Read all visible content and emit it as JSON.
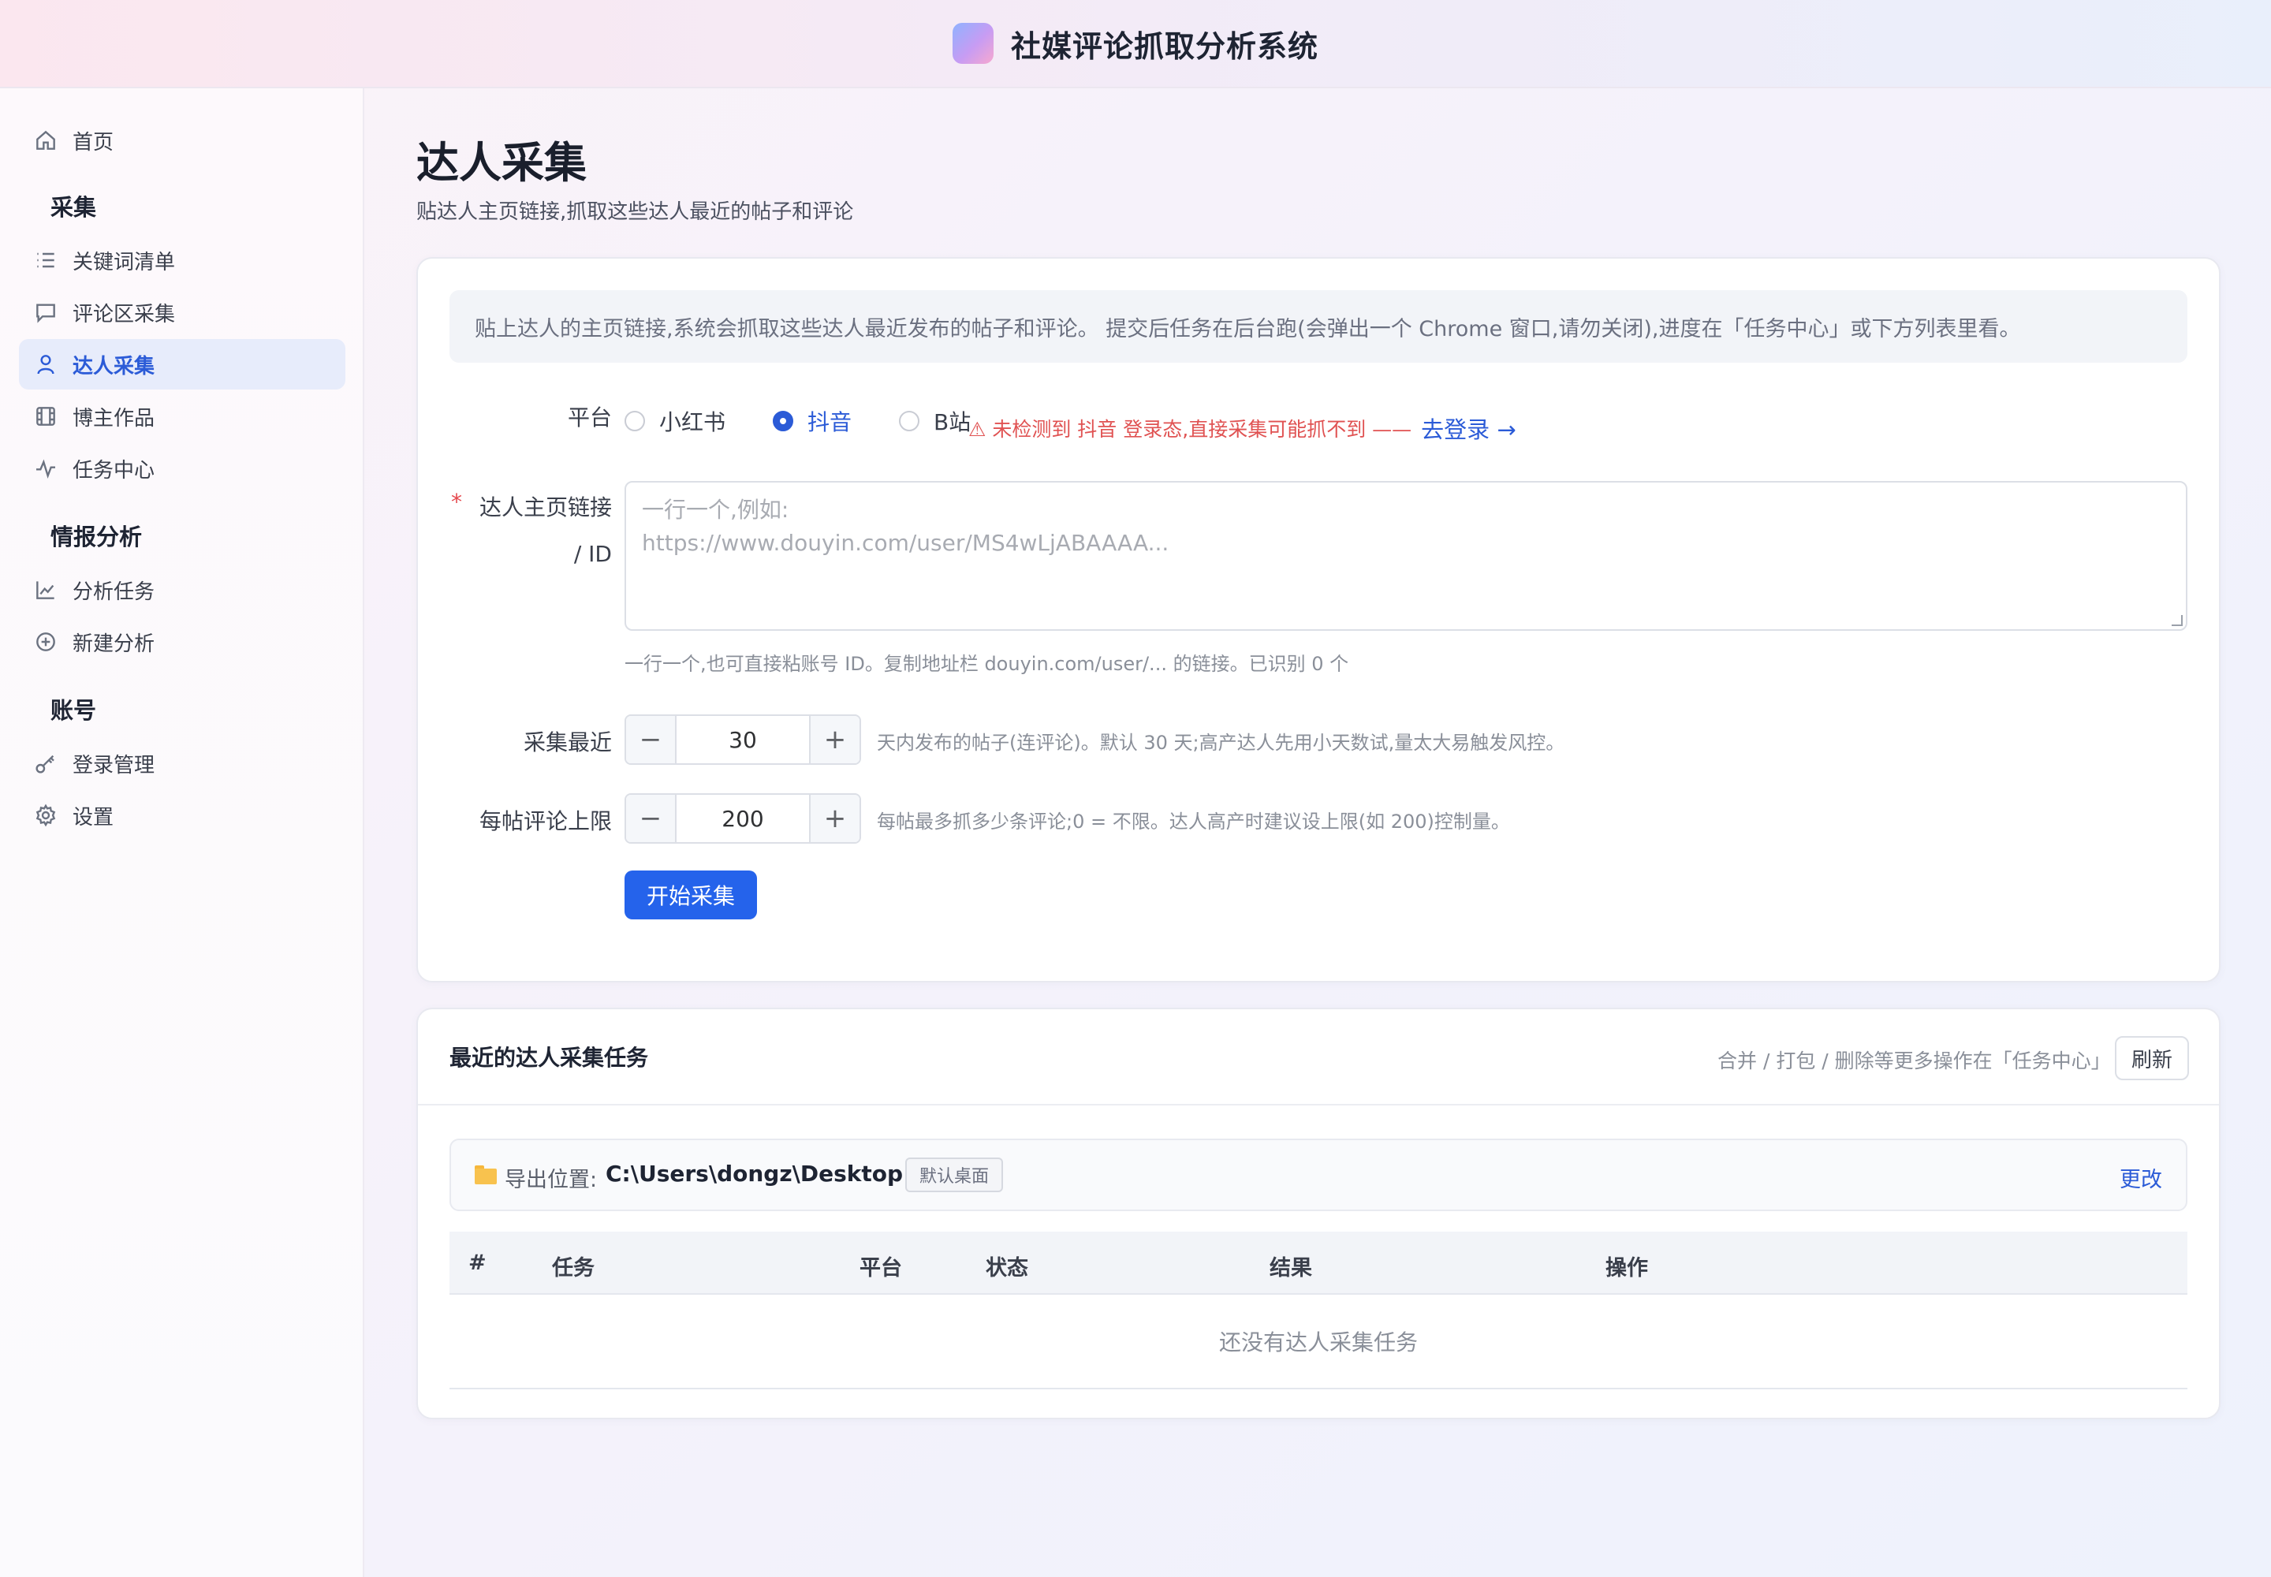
{
  "app": {
    "title": "社媒评论抓取分析系统"
  },
  "sidebar": {
    "home": "首页",
    "groups": {
      "collect": "采集",
      "analysis": "情报分析",
      "account": "账号"
    },
    "items": {
      "keywords": "关键词清单",
      "comments": "评论区采集",
      "influencer": "达人采集",
      "works": "博主作品",
      "tasks": "任务中心",
      "analysis_tasks": "分析任务",
      "new_analysis": "新建分析",
      "login": "登录管理",
      "settings": "设置"
    },
    "active": "influencer"
  },
  "page": {
    "title": "达人采集",
    "subtitle": "贴达人主页链接,抓取这些达人最近的帖子和评论"
  },
  "form": {
    "info": "贴上达人的主页链接,系统会抓取这些达人最近发布的帖子和评论。 提交后任务在后台跑(会弹出一个 Chrome 窗口,请勿关闭),进度在「任务中心」或下方列表里看。",
    "platform_label": "平台",
    "platforms": [
      "小红书",
      "抖音",
      "B站"
    ],
    "selected_platform": "抖音",
    "warning": "⚠ 未检测到 抖音 登录态,直接采集可能抓不到 ——",
    "login_link": "去登录 →",
    "link_label_1": "达人主页链接",
    "link_label_2": "/ ID",
    "required_mark": "*",
    "textarea_placeholder_1": "一行一个,例如:",
    "textarea_placeholder_2": "https://www.douyin.com/user/MS4wLjABAAAA...",
    "link_hint": "一行一个,也可直接粘账号 ID。复制地址栏 douyin.com/user/... 的链接。已识别 0 个",
    "days_label": "采集最近",
    "days_value": "30",
    "days_hint": "天内发布的帖子(连评论)。默认 30 天;高产达人先用小天数试,量太大易触发风控。",
    "comments_label": "每帖评论上限",
    "comments_value": "200",
    "comments_hint": "每帖最多抓多少条评论;0 = 不限。达人高产时建议设上限(如 200)控制量。",
    "minus": "−",
    "plus": "+",
    "submit": "开始采集"
  },
  "tasks": {
    "title": "最近的达人采集任务",
    "note": "合并 / 打包 / 删除等更多操作在「任务中心」",
    "refresh": "刷新",
    "export_label": "导出位置:",
    "export_path": "C:\\Users\\dongz\\Desktop",
    "export_badge": "默认桌面",
    "change": "更改",
    "columns": [
      "#",
      "任务",
      "平台",
      "状态",
      "结果",
      "操作"
    ],
    "empty": "还没有达人采集任务"
  },
  "colors": {
    "accent": "#2563eb",
    "active_nav_bg": "#e7ecfb",
    "warning": "#e05252"
  }
}
